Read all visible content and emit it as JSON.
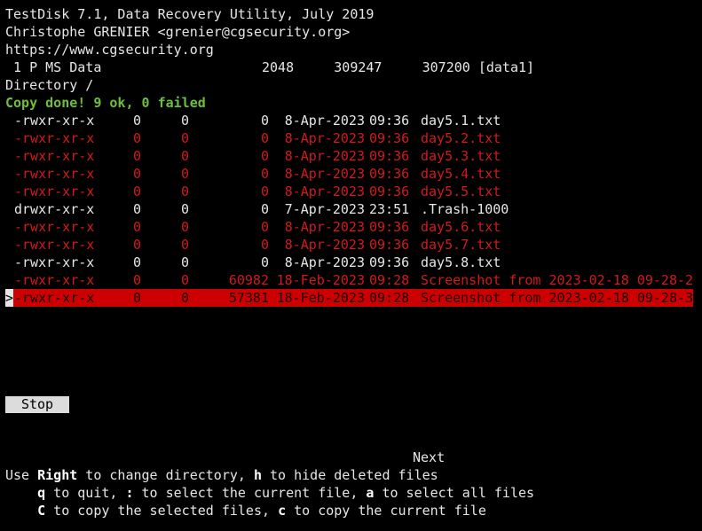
{
  "header": {
    "line1": "TestDisk 7.1, Data Recovery Utility, July 2019",
    "line2": "Christophe GRENIER <grenier@cgsecurity.org>",
    "line3": "https://www.cgsecurity.org",
    "partition": " 1 P MS Data                    2048     309247     307200 [data1]",
    "directory": "Directory /",
    "status": "Copy done! 9 ok, 0 failed"
  },
  "files": [
    {
      "perm": "-rwxr-xr-x",
      "uid": "0",
      "gid": "0",
      "size": "0",
      "date": "8-Apr-2023",
      "time": "09:36",
      "name": "day5.1.txt",
      "deleted": false
    },
    {
      "perm": "-rwxr-xr-x",
      "uid": "0",
      "gid": "0",
      "size": "0",
      "date": "8-Apr-2023",
      "time": "09:36",
      "name": "day5.2.txt",
      "deleted": true
    },
    {
      "perm": "-rwxr-xr-x",
      "uid": "0",
      "gid": "0",
      "size": "0",
      "date": "8-Apr-2023",
      "time": "09:36",
      "name": "day5.3.txt",
      "deleted": true
    },
    {
      "perm": "-rwxr-xr-x",
      "uid": "0",
      "gid": "0",
      "size": "0",
      "date": "8-Apr-2023",
      "time": "09:36",
      "name": "day5.4.txt",
      "deleted": true
    },
    {
      "perm": "-rwxr-xr-x",
      "uid": "0",
      "gid": "0",
      "size": "0",
      "date": "8-Apr-2023",
      "time": "09:36",
      "name": "day5.5.txt",
      "deleted": true
    },
    {
      "perm": "drwxr-xr-x",
      "uid": "0",
      "gid": "0",
      "size": "0",
      "date": "7-Apr-2023",
      "time": "23:51",
      "name": ".Trash-1000",
      "deleted": false
    },
    {
      "perm": "-rwxr-xr-x",
      "uid": "0",
      "gid": "0",
      "size": "0",
      "date": "8-Apr-2023",
      "time": "09:36",
      "name": "day5.6.txt",
      "deleted": true
    },
    {
      "perm": "-rwxr-xr-x",
      "uid": "0",
      "gid": "0",
      "size": "0",
      "date": "8-Apr-2023",
      "time": "09:36",
      "name": "day5.7.txt",
      "deleted": true
    },
    {
      "perm": "-rwxr-xr-x",
      "uid": "0",
      "gid": "0",
      "size": "0",
      "date": "8-Apr-2023",
      "time": "09:36",
      "name": "day5.8.txt",
      "deleted": false
    },
    {
      "perm": "-rwxr-xr-x",
      "uid": "0",
      "gid": "0",
      "size": "60982",
      "date": "18-Feb-2023",
      "time": "09:28",
      "name": "Screenshot from 2023-02-18 09-28-2",
      "deleted": true
    },
    {
      "perm": "-rwxr-xr-x",
      "uid": "0",
      "gid": "0",
      "size": "57381",
      "date": "18-Feb-2023",
      "time": "09:28",
      "name": "Screenshot from 2023-02-18 09-28-3",
      "deleted": true,
      "selected": true
    }
  ],
  "cursor": ">",
  "stop_label": "Stop",
  "next_label": "Next",
  "help": {
    "l1_a": "Use ",
    "l1_key1": "Right",
    "l1_b": " to change directory, ",
    "l1_key2": "h",
    "l1_c": " to hide deleted files",
    "l2_a": "    ",
    "l2_key1": "q",
    "l2_b": " to quit, ",
    "l2_key2": ":",
    "l2_c": " to select the current file, ",
    "l2_key3": "a",
    "l2_d": " to select all files",
    "l3_a": "    ",
    "l3_key1": "C",
    "l3_b": " to copy the selected files, ",
    "l3_key2": "c",
    "l3_c": " to copy the current file"
  },
  "colors": {
    "deleted": "#d11a1a",
    "selected_bg": "#cc0000",
    "status": "#6fbf3a"
  }
}
